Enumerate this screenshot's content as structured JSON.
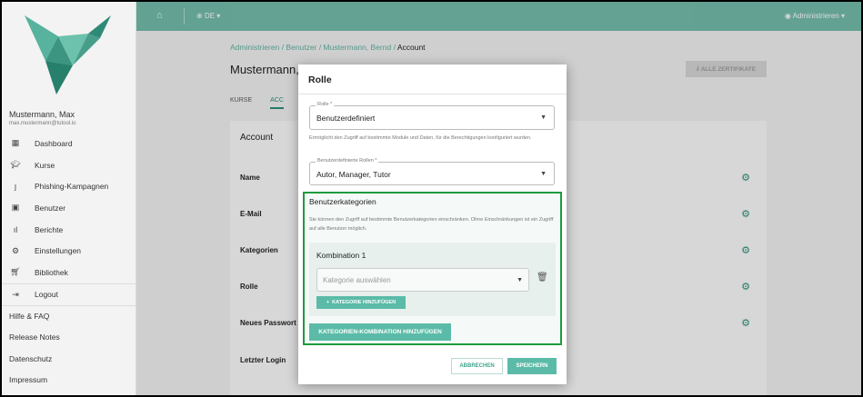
{
  "sidebar": {
    "user_name": "Mustermann, Max",
    "user_email": "max.mustermann@tutool.io",
    "items": [
      {
        "label": "Dashboard",
        "icon": "dashboard-icon"
      },
      {
        "label": "Kurse",
        "icon": "graduation-cap-icon"
      },
      {
        "label": "Phishing-Kampagnen",
        "icon": "hook-icon"
      },
      {
        "label": "Benutzer",
        "icon": "user-badge-icon"
      },
      {
        "label": "Berichte",
        "icon": "bar-chart-icon"
      },
      {
        "label": "Einstellungen",
        "icon": "gear-icon"
      },
      {
        "label": "Bibliothek",
        "icon": "cart-icon"
      },
      {
        "label": "Logout",
        "icon": "logout-icon"
      }
    ],
    "footer_links": [
      "Hilfe & FAQ",
      "Release Notes",
      "Datenschutz",
      "Impressum"
    ]
  },
  "topbar": {
    "language": "DE",
    "user_menu": "Administrieren"
  },
  "main": {
    "breadcrumb": [
      "Administrieren",
      "Benutzer",
      "Mustermann, Bernd",
      "Account"
    ],
    "page_title": "Mustermann, B",
    "cert_button": "ALLE ZERTIFIKATE",
    "tabs": [
      "KURSE",
      "ACC"
    ],
    "card_title": "Account",
    "fields": [
      "Name",
      "E-Mail",
      "Kategorien",
      "Rolle",
      "Neues Passwort v",
      "Letzter Login"
    ]
  },
  "modal": {
    "title": "Rolle",
    "role_label": "Rolle *",
    "role_value": "Benutzerdefiniert",
    "role_hint": "Ermöglicht den Zugriff auf bestimmte Module und Daten, für die Berechtigungen konfiguriert wurden.",
    "custom_roles_label": "Benutzerdefinierte Rollen *",
    "custom_roles_value": "Autor, Manager, Tutor",
    "categories_title": "Benutzerkategorien",
    "categories_hint": "Sie können den Zugriff auf bestimmte Benutzerkategorien einschränken. Ohne Einschränkungen ist ein Zugriff auf alle Benutzer möglich.",
    "combination_title": "Kombination 1",
    "category_placeholder": "Kategorie auswählen",
    "add_category_button": "KATEGORIE HINZUFÜGEN",
    "add_combination_button": "KATEGORIEN-KOMBINATION HINZUFÜGEN",
    "cancel_button": "ABBRECHEN",
    "save_button": "SPEICHERN"
  },
  "colors": {
    "brand": "#3fa48d",
    "button": "#5bbba8",
    "highlight": "#1e9b3d"
  }
}
